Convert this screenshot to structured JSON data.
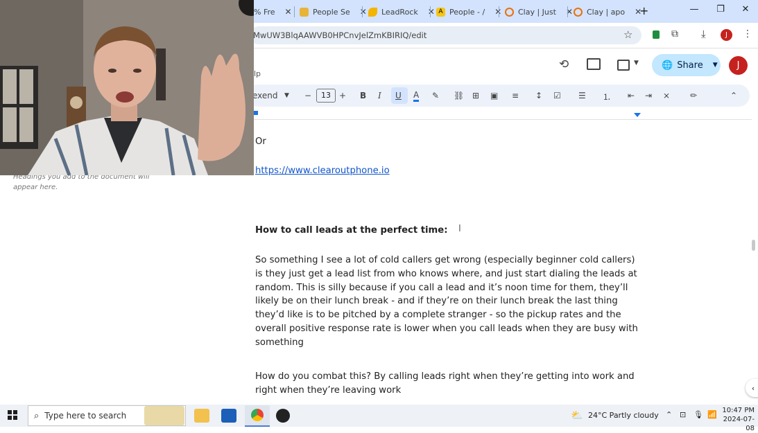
{
  "browser": {
    "tabs": [
      {
        "title": "% Fre",
        "favicon_color": "#1a73e8"
      },
      {
        "title": "People Se",
        "favicon_color": "#e8b339"
      },
      {
        "title": "LeadRock",
        "favicon_color": "#f4b400"
      },
      {
        "title": "People - /",
        "favicon_color": "#f5c518"
      },
      {
        "title": "Clay | Just",
        "favicon_color": "#e8710a"
      },
      {
        "title": "Clay | apo",
        "favicon_color": "#e8710a"
      }
    ],
    "new_tab": "+",
    "url": "MwUW3BlqAAWVB0HPCnvJelZmKBIRIQ/edit",
    "window_controls": {
      "minimize": "—",
      "restore": "❐",
      "close": "✕"
    },
    "profile_initial": "J"
  },
  "docs": {
    "menu_fragment": "lp",
    "share_label": "Share",
    "avatar_initial": "J",
    "font_name": "exend",
    "font_size": "13",
    "outline_hint": "Headings you add to the document will appear here."
  },
  "document": {
    "line_or": "Or",
    "link": "https://www.clearoutphone.io",
    "heading": "How to call leads at the perfect time:",
    "paragraph1": "So something I see a lot of cold callers get wrong (especially beginner cold callers) is they just get a lead list from who knows where, and just start dialing the leads at random. This is silly because if you call a lead and it’s noon time for them, they’ll likely be on their lunch break - and if they’re on their lunch break the last thing they’d like is to be pitched by a complete stranger - so the pickup rates and the overall positive response rate is lower when you call leads when they are busy with something",
    "paragraph2": "How do you combat this? By calling leads right when they’re getting into work and right when they’re leaving work"
  },
  "taskbar": {
    "search_placeholder": "Type here to search",
    "weather": "24°C  Partly cloudy",
    "time": "10:47 PM",
    "date": "2024-07-08"
  },
  "colors": {
    "accent": "#1a73e8",
    "share_bg": "#c2e7ff",
    "avatar": "#c5221f",
    "link": "#1155cc"
  }
}
